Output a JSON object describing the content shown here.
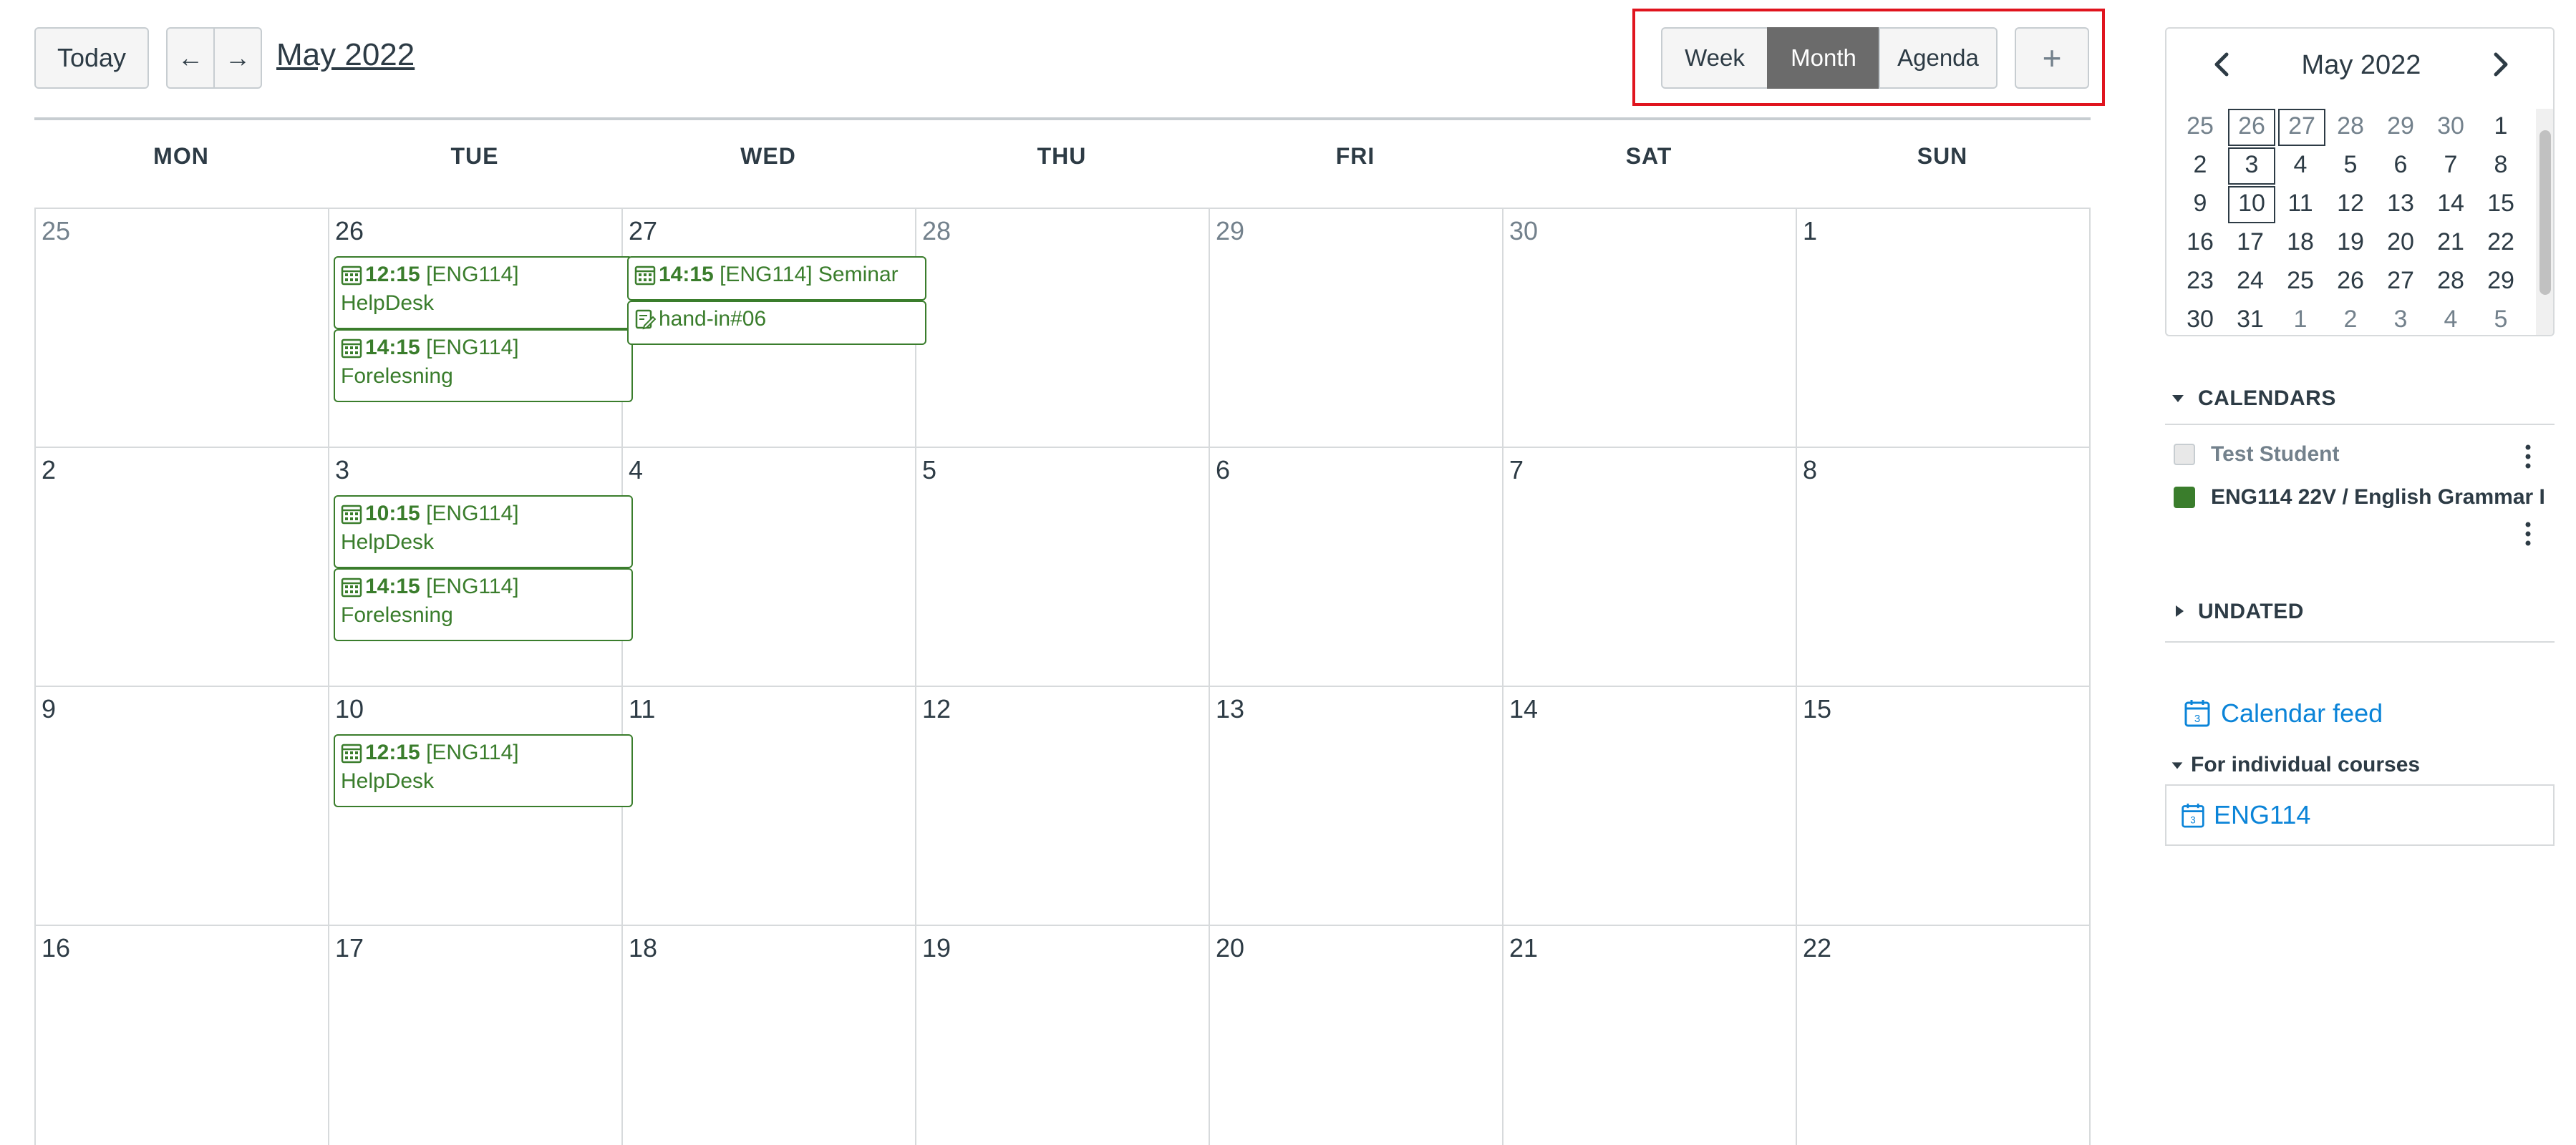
{
  "toolbar": {
    "today_label": "Today",
    "prev_arrow": "←",
    "next_arrow": "→",
    "month_title": "May 2022",
    "views": [
      {
        "label": "Week",
        "active": false
      },
      {
        "label": "Month",
        "active": true
      },
      {
        "label": "Agenda",
        "active": false
      }
    ],
    "add_label": "+"
  },
  "weekdays": [
    "MON",
    "TUE",
    "WED",
    "THU",
    "FRI",
    "SAT",
    "SUN"
  ],
  "weeks": [
    [
      {
        "day": "25",
        "other": true,
        "events": []
      },
      {
        "day": "26",
        "other": false,
        "events": [
          {
            "type": "calendar",
            "time": "12:15",
            "title": "[ENG114]",
            "subtitle": "HelpDesk"
          },
          {
            "type": "calendar",
            "time": "14:15",
            "title": "[ENG114]",
            "subtitle": "Forelesning"
          }
        ]
      },
      {
        "day": "27",
        "other": false,
        "events": [
          {
            "type": "calendar",
            "time": "14:15",
            "title": "[ENG114] Seminar",
            "subtitle": ""
          },
          {
            "type": "assignment",
            "time": "",
            "title": "hand-in#06",
            "subtitle": ""
          }
        ]
      },
      {
        "day": "28",
        "other": true,
        "events": []
      },
      {
        "day": "29",
        "other": true,
        "events": []
      },
      {
        "day": "30",
        "other": true,
        "events": []
      },
      {
        "day": "1",
        "other": false,
        "events": []
      }
    ],
    [
      {
        "day": "2",
        "other": false,
        "events": []
      },
      {
        "day": "3",
        "other": false,
        "events": [
          {
            "type": "calendar",
            "time": "10:15",
            "title": "[ENG114]",
            "subtitle": "HelpDesk"
          },
          {
            "type": "calendar",
            "time": "14:15",
            "title": "[ENG114]",
            "subtitle": "Forelesning"
          }
        ]
      },
      {
        "day": "4",
        "other": false,
        "events": []
      },
      {
        "day": "5",
        "other": false,
        "events": []
      },
      {
        "day": "6",
        "other": false,
        "events": []
      },
      {
        "day": "7",
        "other": false,
        "events": []
      },
      {
        "day": "8",
        "other": false,
        "events": []
      }
    ],
    [
      {
        "day": "9",
        "other": false,
        "events": []
      },
      {
        "day": "10",
        "other": false,
        "events": [
          {
            "type": "calendar",
            "time": "12:15",
            "title": "[ENG114]",
            "subtitle": "HelpDesk"
          }
        ]
      },
      {
        "day": "11",
        "other": false,
        "events": []
      },
      {
        "day": "12",
        "other": false,
        "events": []
      },
      {
        "day": "13",
        "other": false,
        "events": []
      },
      {
        "day": "14",
        "other": false,
        "events": []
      },
      {
        "day": "15",
        "other": false,
        "events": []
      }
    ],
    [
      {
        "day": "16",
        "other": false,
        "events": []
      },
      {
        "day": "17",
        "other": false,
        "events": []
      },
      {
        "day": "18",
        "other": false,
        "events": []
      },
      {
        "day": "19",
        "other": false,
        "events": []
      },
      {
        "day": "20",
        "other": false,
        "events": []
      },
      {
        "day": "21",
        "other": false,
        "events": []
      },
      {
        "day": "22",
        "other": false,
        "events": []
      }
    ]
  ],
  "mini_calendar": {
    "title": "May 2022",
    "prev": "‹",
    "next": "›",
    "rows": [
      [
        {
          "d": "25",
          "o": true
        },
        {
          "d": "26",
          "o": true,
          "b": true
        },
        {
          "d": "27",
          "o": true,
          "b": true
        },
        {
          "d": "28",
          "o": true
        },
        {
          "d": "29",
          "o": true
        },
        {
          "d": "30",
          "o": true
        },
        {
          "d": "1"
        }
      ],
      [
        {
          "d": "2"
        },
        {
          "d": "3",
          "b": true
        },
        {
          "d": "4"
        },
        {
          "d": "5"
        },
        {
          "d": "6"
        },
        {
          "d": "7"
        },
        {
          "d": "8"
        }
      ],
      [
        {
          "d": "9"
        },
        {
          "d": "10",
          "b": true
        },
        {
          "d": "11"
        },
        {
          "d": "12"
        },
        {
          "d": "13"
        },
        {
          "d": "14"
        },
        {
          "d": "15"
        }
      ],
      [
        {
          "d": "16"
        },
        {
          "d": "17"
        },
        {
          "d": "18"
        },
        {
          "d": "19"
        },
        {
          "d": "20"
        },
        {
          "d": "21"
        },
        {
          "d": "22"
        }
      ],
      [
        {
          "d": "23"
        },
        {
          "d": "24"
        },
        {
          "d": "25"
        },
        {
          "d": "26"
        },
        {
          "d": "27"
        },
        {
          "d": "28"
        },
        {
          "d": "29"
        }
      ],
      [
        {
          "d": "30"
        },
        {
          "d": "31"
        },
        {
          "d": "1",
          "o": true
        },
        {
          "d": "2",
          "o": true
        },
        {
          "d": "3",
          "o": true
        },
        {
          "d": "4",
          "o": true
        },
        {
          "d": "5",
          "o": true
        }
      ]
    ]
  },
  "sidebar": {
    "calendars_title": "CALENDARS",
    "calendars": [
      {
        "name": "Test Student",
        "color": "#e8e8e8",
        "checked": false
      },
      {
        "name": "ENG114 22V / English Grammar I",
        "color": "#3a7d2c",
        "checked": true
      }
    ],
    "undated_title": "UNDATED",
    "feed_label": "Calendar feed",
    "individual_title": "For individual courses",
    "course_feed_label": "ENG114"
  },
  "colors": {
    "event_green": "#3a7d2c",
    "highlight_red": "#e0141e",
    "link_blue": "#0b84d8"
  }
}
